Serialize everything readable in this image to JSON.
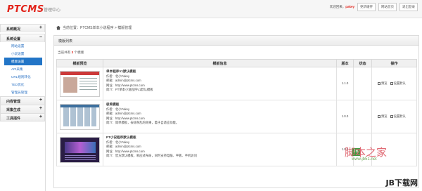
{
  "header": {
    "logo": "PTCMS",
    "logo_sub": "管理中心",
    "welcome": "欢迎回来，",
    "user": "pakey",
    "buttons": [
      "更新缓存",
      "网站首页",
      "退出登录"
    ]
  },
  "sidebar": {
    "sections": [
      {
        "label": "系统概况",
        "toggle": "+"
      },
      {
        "label": "系统设置",
        "toggle": "−",
        "items": [
          {
            "label": "网站设置"
          },
          {
            "label": "小说设置"
          },
          {
            "label": "模版设置",
            "active": true
          },
          {
            "label": "API采集"
          },
          {
            "label": "URL规则转化"
          },
          {
            "label": "TED优化"
          },
          {
            "label": "管理员管理"
          }
        ]
      },
      {
        "label": "内容管理",
        "toggle": "+"
      },
      {
        "label": "采集生成",
        "toggle": "+"
      },
      {
        "label": "工具插件",
        "toggle": "+"
      }
    ]
  },
  "breadcrumb": "当前位置：PTCMS单本小说程序 > 模版管理",
  "panel": {
    "title": "模版列表",
    "count_prefix": "当前共有",
    "count": "3",
    "count_suffix": "个模版"
  },
  "table": {
    "headers": [
      "模板预览",
      "模板信息",
      "版本",
      "状态",
      "操作"
    ],
    "rows": [
      {
        "name": "单本程序V1默认模板",
        "author": "作者：北小Fakey",
        "email": "邮箱：admin@ptcms.com",
        "site": "网址：http://www.ptcms.com",
        "desc": "简介：PT单本小说程序V1默认模板",
        "version": "1.1.0",
        "status": "",
        "op1": "预览",
        "op2": "设置默认"
      },
      {
        "name": "极简模板",
        "author": "作者：北小Fakey",
        "email": "邮箱：admin@ptcms.com",
        "site": "网址：http://www.ptcms.com",
        "desc": "简介：简单模板，去除杂乱的效果，着于自适应功能。",
        "version": "1.0.0",
        "status": "",
        "op1": "预览",
        "op2": "设置默认"
      },
      {
        "name": "PT小说程序默认模板",
        "author": "作者：北小Fakey",
        "email": "邮箱：admin@ptcms.com",
        "site": "网址：http://www.ptcms.com",
        "desc": "简介：官方默认模板，响应式布局，同时支持电脑、平板、手机访问",
        "version": "1.0.0",
        "status": "",
        "op1": "",
        "op2": ""
      }
    ]
  },
  "watermark": {
    "cn": "脚本之家",
    "url": "www.jb51.net",
    "badge": "JB",
    "corner": "JB下载网"
  }
}
